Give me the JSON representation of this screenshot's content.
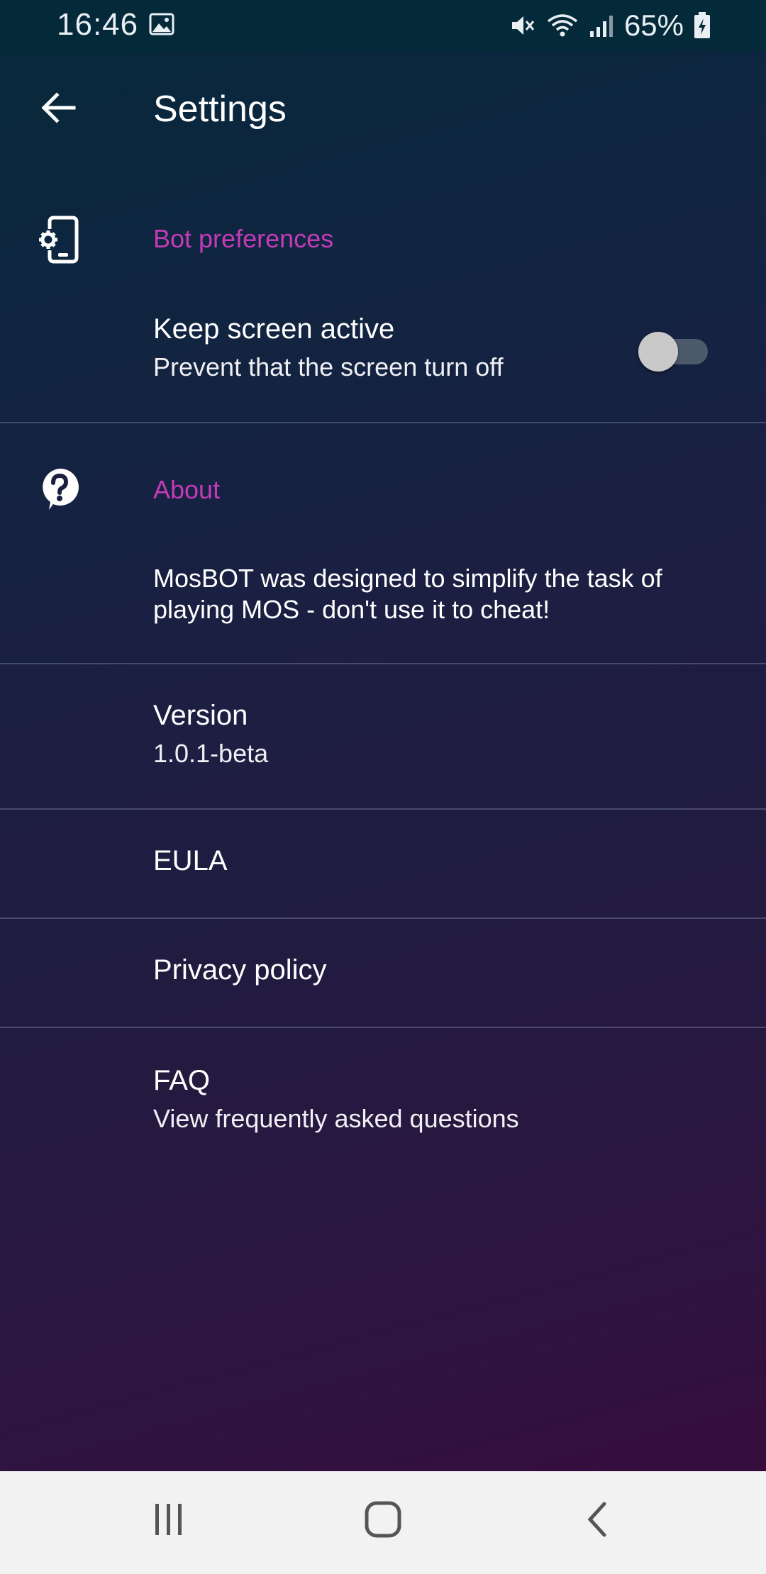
{
  "status_bar": {
    "time": "16:46",
    "battery": "65%"
  },
  "app_bar": {
    "title": "Settings"
  },
  "bot_preferences": {
    "header": "Bot preferences",
    "keep_screen": {
      "title": "Keep screen active",
      "summary": "Prevent that the screen turn off",
      "enabled": false
    }
  },
  "about": {
    "header": "About",
    "description_line1": "MosBOT was designed to simplify the task of",
    "description_line2": "playing MOS - don't use it to cheat!",
    "version_title": "Version",
    "version_value": "1.0.1-beta",
    "eula": "EULA",
    "privacy": "Privacy policy",
    "faq_title": "FAQ",
    "faq_summary": "View frequently asked questions"
  },
  "colors": {
    "accent": "#c43bb8",
    "status_bar": "#042a3a",
    "nav_bar": "#f2f2f2"
  },
  "icons": {
    "back": "arrow-left-icon",
    "bot_preferences": "phone-settings-icon",
    "about": "help-circle-icon",
    "nav_recents": "recents-icon",
    "nav_home": "home-icon",
    "nav_back": "nav-back-icon"
  }
}
